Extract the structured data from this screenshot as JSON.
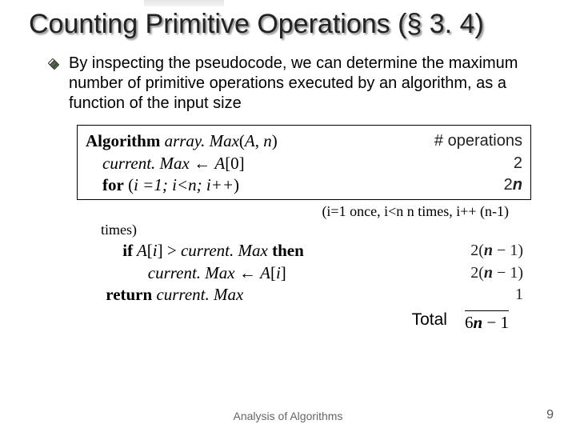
{
  "title": "Counting Primitive Operations (§ 3. 4)",
  "bullet": "By inspecting the pseudocode, we can determine the maximum number of primitive operations executed by an algorithm, as a function of the input size",
  "algo": {
    "sig_label": "Algorithm",
    "sig_name": "array. Max",
    "sig_args_open": "(",
    "sig_arg1": "A",
    "sig_comma": ", ",
    "sig_arg2": "n",
    "sig_args_close": ")",
    "line2_lhs": "current. Max",
    "line2_arrow": " ← ",
    "line2_rhs_A": "A",
    "line2_rhs_idx": "[0]",
    "line3_for": "for",
    "line3_cond_open": " (",
    "line3_cond": "i =1; i<n; i++",
    "line3_cond_close": ")",
    "note": "(i=1 once, i<n  n times, i++ (n-1)",
    "times": "times)",
    "line4_if": "if",
    "line4_A": " A",
    "line4_idx": "[",
    "line4_i": "i",
    "line4_idx2": "] > ",
    "line4_cm": "current. Max",
    "line4_then": " then",
    "line5_cm": "current. Max",
    "line5_arrow": " ← ",
    "line5_A": "A",
    "line5_idx": "[",
    "line5_i": "i",
    "line5_idx2": "]",
    "line6_ret": "return",
    "line6_cm": " current. Max"
  },
  "ops": {
    "header": "# operations",
    "r1": "2",
    "r2_pre": "2",
    "r2_n": "n",
    "r3_pre": "2(",
    "r3_n": "n",
    "r3_post": " − 1)",
    "r4_pre": "2(",
    "r4_n": "n",
    "r4_post": " − 1)",
    "r5": "1"
  },
  "total": {
    "label": "Total",
    "pre": "6",
    "n": "n",
    "post": " − 1"
  },
  "footer": {
    "center": "Analysis of Algorithms",
    "page": "9"
  }
}
